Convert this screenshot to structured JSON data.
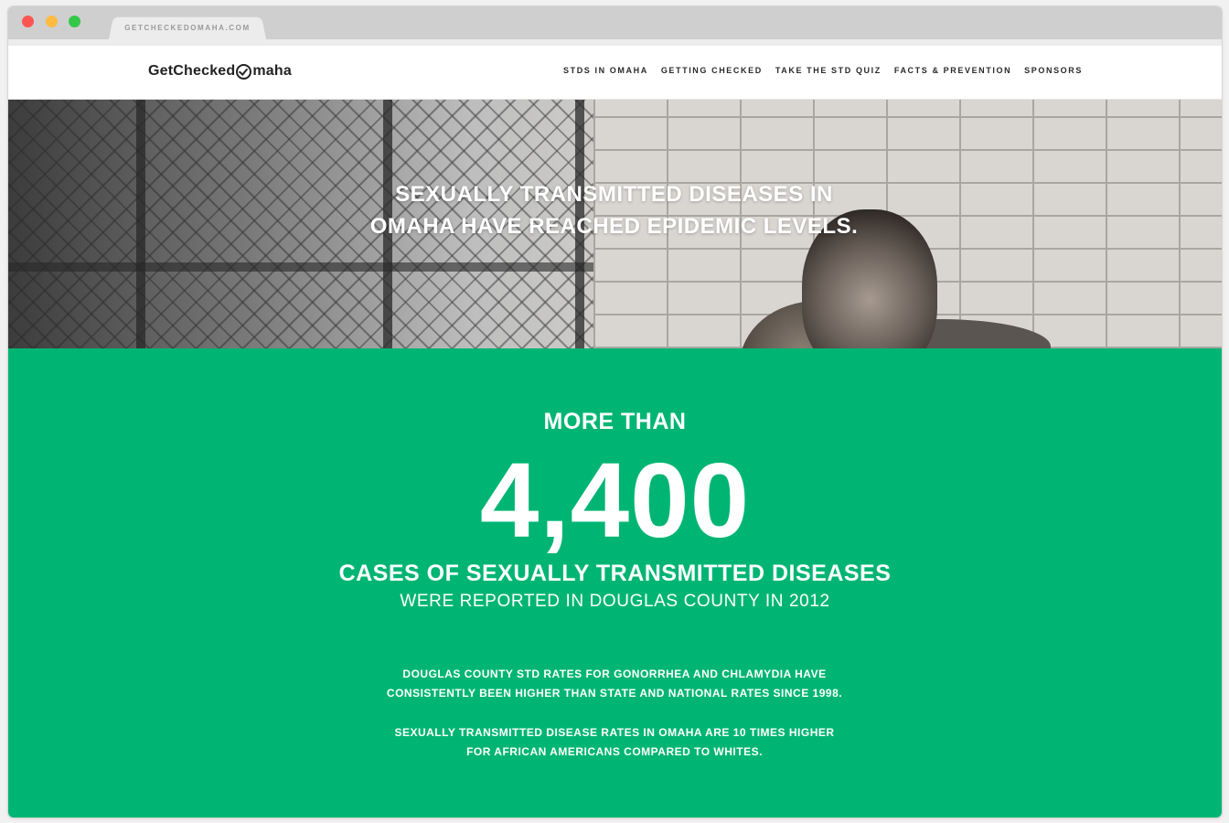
{
  "browser": {
    "tab_url": "GETCHECKEDOMAHA.COM"
  },
  "header": {
    "logo_left": "GetChecked",
    "logo_right": "maha",
    "nav": [
      {
        "label": "STDS IN OMAHA"
      },
      {
        "label": "GETTING CHECKED"
      },
      {
        "label": "TAKE THE STD QUIZ"
      },
      {
        "label": "FACTS & PREVENTION"
      },
      {
        "label": "SPONSORS"
      }
    ]
  },
  "hero": {
    "headline": "SEXUALLY TRANSMITTED DISEASES IN OMAHA HAVE REACHED EPIDEMIC LEVELS."
  },
  "stats": {
    "lead": "MORE THAN",
    "number": "4,400",
    "subject": "CASES OF SEXUALLY TRANSMITTED DISEASES",
    "detail": "WERE REPORTED IN DOUGLAS COUNTY IN 2012",
    "paragraphs": [
      "DOUGLAS COUNTY STD RATES FOR GONORRHEA AND CHLAMYDIA HAVE CONSISTENTLY BEEN HIGHER THAN STATE AND NATIONAL RATES SINCE 1998.",
      "SEXUALLY TRANSMITTED DISEASE RATES IN OMAHA ARE 10 TIMES HIGHER FOR AFRICAN AMERICANS COMPARED TO WHITES."
    ]
  },
  "colors": {
    "accent": "#00b574",
    "light_red": "#fc5652",
    "light_yellow": "#fdbc40",
    "light_green": "#34c84a"
  }
}
